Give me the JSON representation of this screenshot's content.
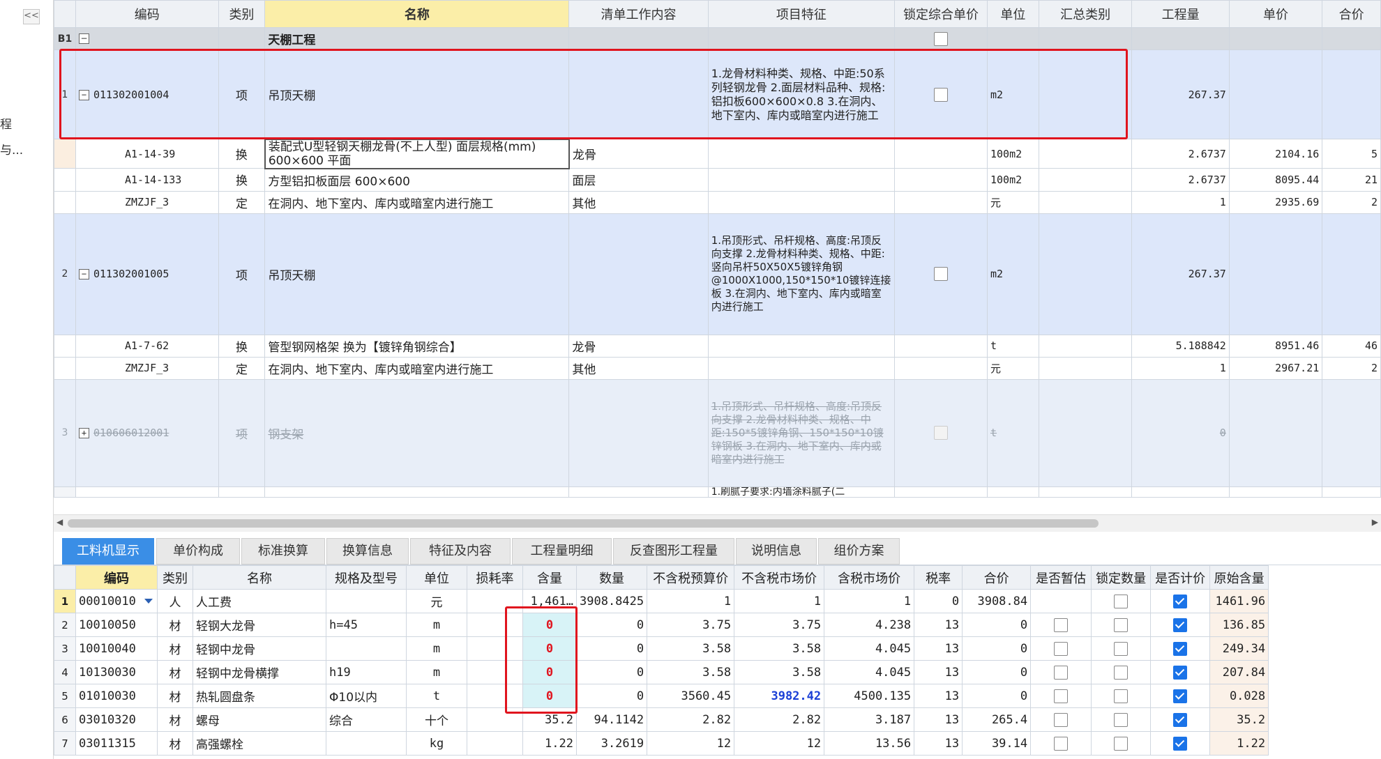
{
  "sidebar": {
    "collapse": "<<",
    "text1": "程",
    "text2": "与..."
  },
  "upper": {
    "headers": [
      "编码",
      "类别",
      "名称",
      "清单工作内容",
      "项目特征",
      "锁定综合单价",
      "单位",
      "汇总类别",
      "工程量",
      "单价",
      "合价"
    ],
    "group": {
      "no": "B1",
      "name": "天棚工程"
    },
    "item1": {
      "no": "1",
      "code": "011302001004",
      "type": "项",
      "name": "吊顶天棚",
      "feature": "1.龙骨材料种类、规格、中距:50系列轻钢龙骨\n2.面层材料品种、规格:铝扣板600×600×0.8\n3.在洞内、地下室内、库内或暗室内进行施工",
      "unit": "m2",
      "qty": "267.37"
    },
    "sub1": [
      {
        "code": "A1-14-39",
        "type": "换",
        "name": "装配式U型轻钢天棚龙骨(不上人型) 面层规格(mm) 600×600 平面",
        "work": "龙骨",
        "unit": "100m2",
        "qty": "2.6737",
        "price": "2104.16",
        "total": "5"
      },
      {
        "code": "A1-14-133",
        "type": "换",
        "name": "方型铝扣板面层 600×600",
        "work": "面层",
        "unit": "100m2",
        "qty": "2.6737",
        "price": "8095.44",
        "total": "21"
      },
      {
        "code": "ZMZJF_3",
        "type": "定",
        "name": "在洞内、地下室内、库内或暗室内进行施工",
        "work": "其他",
        "unit": "元",
        "qty": "1",
        "price": "2935.69",
        "total": "2"
      }
    ],
    "item2": {
      "no": "2",
      "code": "011302001005",
      "type": "项",
      "name": "吊顶天棚",
      "feature": "1.吊顶形式、吊杆规格、高度:吊顶反向支撑\n2.龙骨材料种类、规格、中距:竖向吊杆50X50X5镀锌角钢@1000X1000,150*150*10镀锌连接板\n3.在洞内、地下室内、库内或暗室内进行施工",
      "unit": "m2",
      "qty": "267.37"
    },
    "sub2": [
      {
        "code": "A1-7-62",
        "type": "换",
        "name": "管型钢网格架  换为【镀锌角钢综合】",
        "work": "龙骨",
        "unit": "t",
        "qty": "5.188842",
        "price": "8951.46",
        "total": "46"
      },
      {
        "code": "ZMZJF_3",
        "type": "定",
        "name": "在洞内、地下室内、库内或暗室内进行施工",
        "work": "其他",
        "unit": "元",
        "qty": "1",
        "price": "2967.21",
        "total": "2"
      }
    ],
    "item3": {
      "no": "3",
      "code": "010606012001",
      "type": "项",
      "name": "钢支架",
      "feature": "1.吊顶形式、吊杆规格、高度:吊顶反向支撑\n2.龙骨材料种类、规格、中距:150*5镀锌角钢、150*150*10镀锌钢板\n3.在洞内、地下室内、库内或暗室内进行施工",
      "unit": "t",
      "qty": "0"
    },
    "partial_feature": "1.刷腻子要求:内墙涂料腻子(二"
  },
  "tabs": [
    "工料机显示",
    "单价构成",
    "标准换算",
    "换算信息",
    "特征及内容",
    "工程量明细",
    "反查图形工程量",
    "说明信息",
    "组价方案"
  ],
  "lower": {
    "headers": [
      "编码",
      "类别",
      "名称",
      "规格及型号",
      "单位",
      "损耗率",
      "含量",
      "数量",
      "不含税预算价",
      "不含税市场价",
      "含税市场价",
      "税率",
      "合价",
      "是否暂估",
      "锁定数量",
      "是否计价",
      "原始含量"
    ],
    "rows": [
      {
        "no": "1",
        "code": "00010010",
        "type": "人",
        "name": "人工费",
        "spec": "",
        "unit": "元",
        "loss": "",
        "content": "1,461…",
        "amount": "3908.8425",
        "pre": "1",
        "mkt": "1",
        "mkttax": "1",
        "tax": "0",
        "total": "3908.84",
        "zg": "",
        "lock": false,
        "priced": true,
        "orig": "1461.96"
      },
      {
        "no": "2",
        "code": "10010050",
        "type": "材",
        "name": "轻钢大龙骨",
        "spec": "h=45",
        "unit": "m",
        "loss": "",
        "content": "0",
        "amount": "0",
        "pre": "3.75",
        "mkt": "3.75",
        "mkttax": "4.238",
        "tax": "13",
        "total": "0",
        "zg": false,
        "lock": false,
        "priced": true,
        "orig": "136.85"
      },
      {
        "no": "3",
        "code": "10010040",
        "type": "材",
        "name": "轻钢中龙骨",
        "spec": "",
        "unit": "m",
        "loss": "",
        "content": "0",
        "amount": "0",
        "pre": "3.58",
        "mkt": "3.58",
        "mkttax": "4.045",
        "tax": "13",
        "total": "0",
        "zg": false,
        "lock": false,
        "priced": true,
        "orig": "249.34"
      },
      {
        "no": "4",
        "code": "10130030",
        "type": "材",
        "name": "轻钢中龙骨横撑",
        "spec": "h19",
        "unit": "m",
        "loss": "",
        "content": "0",
        "amount": "0",
        "pre": "3.58",
        "mkt": "3.58",
        "mkttax": "4.045",
        "tax": "13",
        "total": "0",
        "zg": false,
        "lock": false,
        "priced": true,
        "orig": "207.84"
      },
      {
        "no": "5",
        "code": "01010030",
        "type": "材",
        "name": "热轧圆盘条",
        "spec": "Φ10以内",
        "unit": "t",
        "loss": "",
        "content": "0",
        "amount": "0",
        "pre": "3560.45",
        "mkt": "3982.42",
        "mkttax": "4500.135",
        "tax": "13",
        "total": "0",
        "zg": false,
        "lock": false,
        "priced": true,
        "orig": "0.028"
      },
      {
        "no": "6",
        "code": "03010320",
        "type": "材",
        "name": "螺母",
        "spec": "综合",
        "unit": "十个",
        "loss": "",
        "content": "35.2",
        "amount": "94.1142",
        "pre": "2.82",
        "mkt": "2.82",
        "mkttax": "3.187",
        "tax": "13",
        "total": "265.4",
        "zg": false,
        "lock": false,
        "priced": true,
        "orig": "35.2"
      },
      {
        "no": "7",
        "code": "03011315",
        "type": "材",
        "name": "高强螺栓",
        "spec": "",
        "unit": "kg",
        "loss": "",
        "content": "1.22",
        "amount": "3.2619",
        "pre": "12",
        "mkt": "12",
        "mkttax": "13.56",
        "tax": "13",
        "total": "39.14",
        "zg": false,
        "lock": false,
        "priced": true,
        "orig": "1.22"
      }
    ]
  }
}
